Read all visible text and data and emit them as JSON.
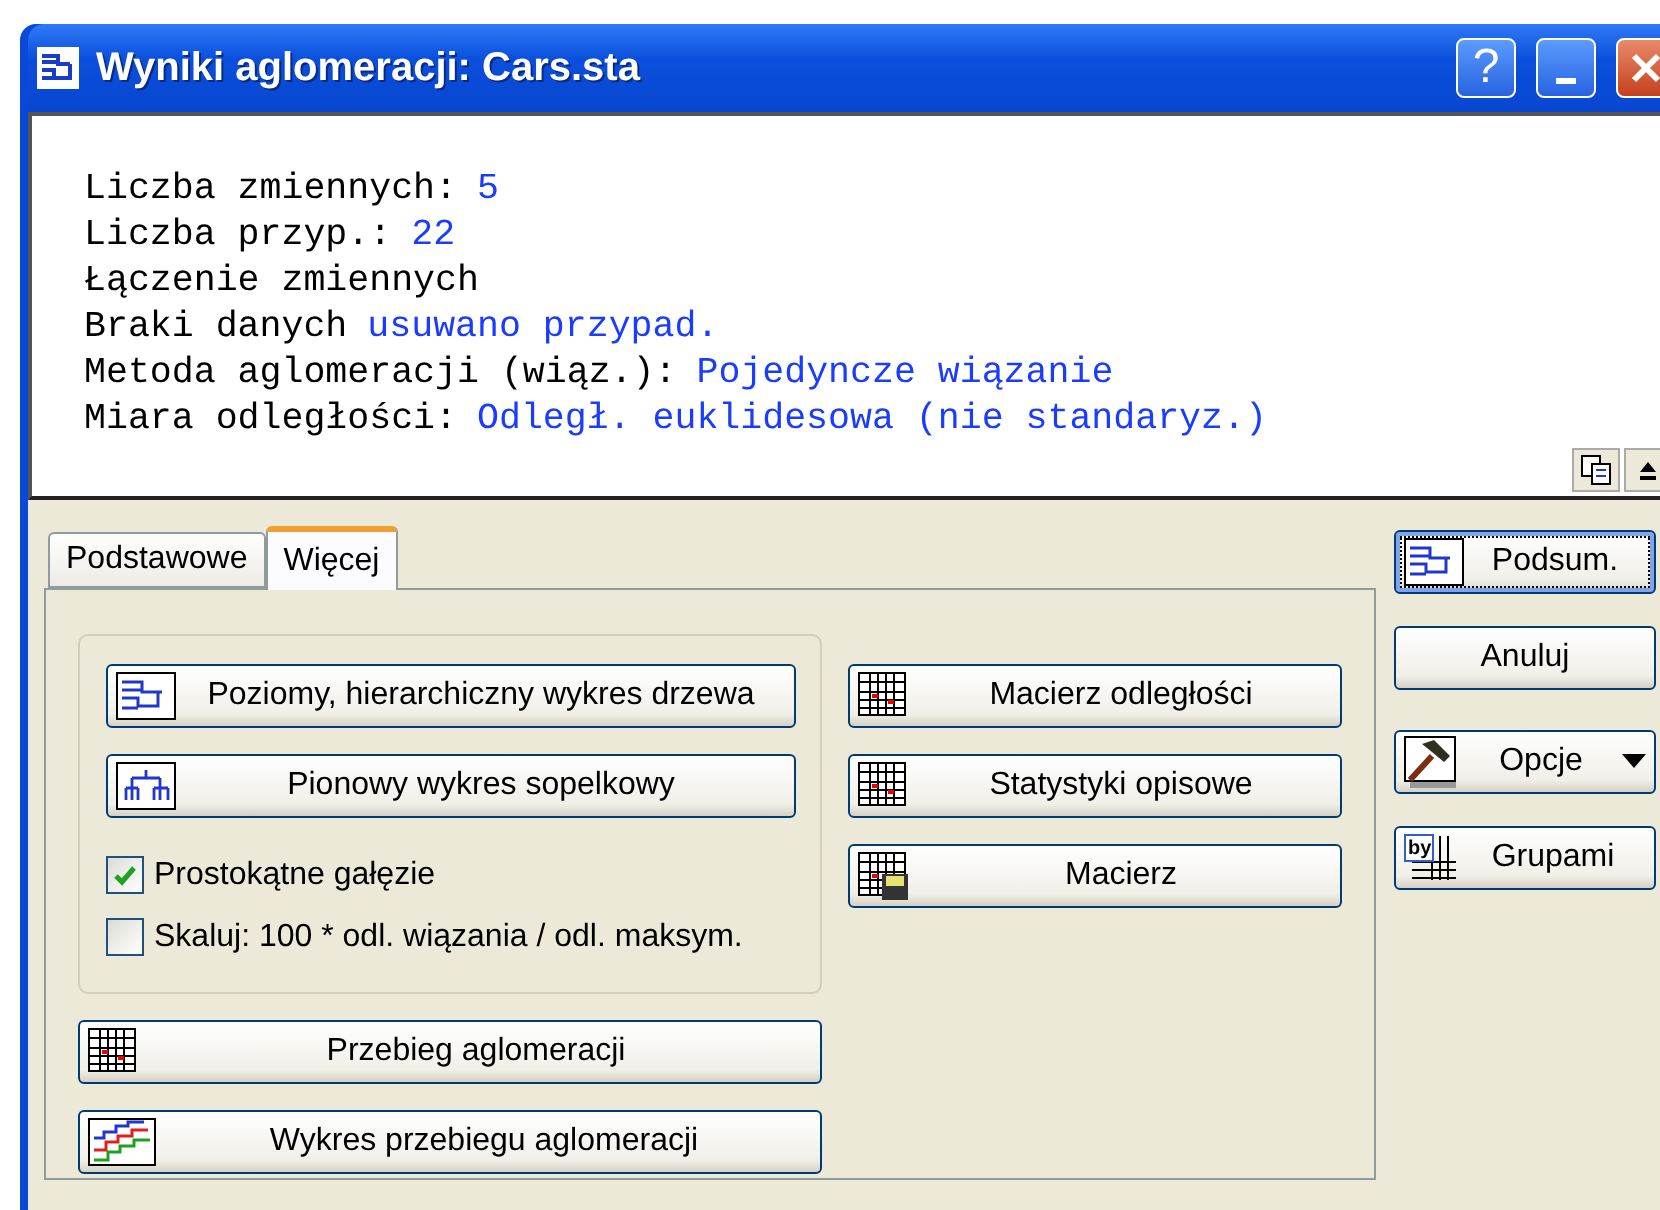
{
  "window": {
    "title": "Wyniki aglomeracji: Cars.sta",
    "controls": [
      {
        "kind": "help",
        "label": "?"
      },
      {
        "kind": "minimize"
      },
      {
        "kind": "close"
      }
    ]
  },
  "output": {
    "lines": [
      {
        "label": "Liczba zmiennych:",
        "value": "5"
      },
      {
        "label": "Liczba przyp.:",
        "value": "22"
      },
      {
        "label": "Łączenie zmiennych"
      },
      {
        "label": "Braki danych",
        "value": "usuwano przypad."
      },
      {
        "label": "Metoda aglomeracji (wiąz.):",
        "value": "Pojedyncze wiązanie"
      },
      {
        "label": "Miara odległości:",
        "value": "Odległ. euklidesowa (nie standaryz.)"
      }
    ],
    "tools": [
      {
        "kind": "copy"
      },
      {
        "kind": "collapse"
      }
    ]
  },
  "tabs": [
    {
      "label": "Podstawowe",
      "selected": false
    },
    {
      "label": "Więcej",
      "selected": true
    }
  ],
  "group": {
    "buttons": [
      {
        "label": "Poziomy, hierarchiczny wykres drzewa",
        "kind": "tree"
      },
      {
        "label": "Pionowy wykres sopelkowy",
        "kind": "icicle"
      }
    ],
    "checkboxes": [
      {
        "label": "Prostokątne gałęzie",
        "checked": true
      },
      {
        "label": "Skaluj: 100 * odl. wiązania / odl. maksym.",
        "checked": false
      }
    ]
  },
  "lower_buttons": [
    {
      "label": "Przebieg aglomeracji",
      "kind": "grid"
    },
    {
      "label": "Wykres przebiegu aglomeracji",
      "kind": "steps"
    }
  ],
  "right_buttons": [
    {
      "label": "Macierz odległości",
      "kind": "grid"
    },
    {
      "label": "Statystyki opisowe",
      "kind": "grid"
    },
    {
      "label": "Macierz",
      "kind": "grid-save"
    }
  ],
  "side_buttons": [
    {
      "label": "Podsum.",
      "kind": "tree",
      "focused": true
    },
    {
      "label": "Anuluj",
      "kind": "plain",
      "focused": false
    },
    {
      "label": "Opcje",
      "kind": "hammer",
      "dropdown": true,
      "focused": false
    },
    {
      "label": "Grupami",
      "kind": "by",
      "icon_text": "by",
      "focused": false
    }
  ]
}
